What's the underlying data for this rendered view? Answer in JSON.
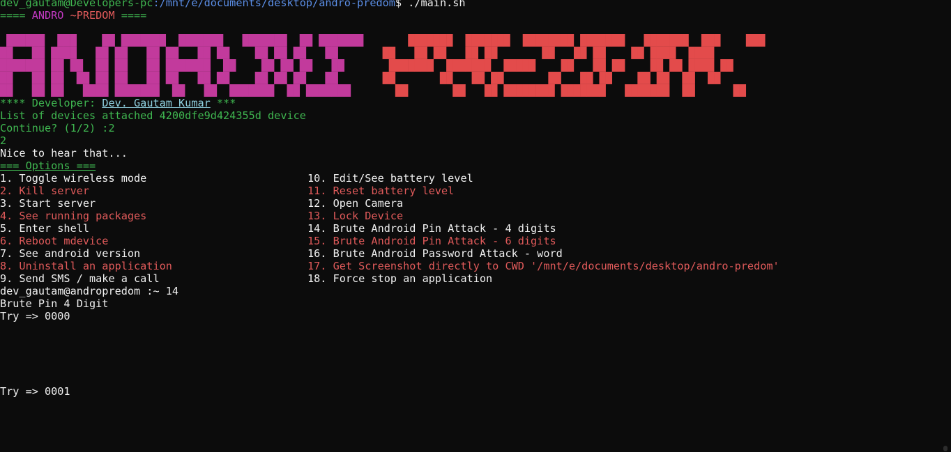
{
  "prompt": {
    "user_host": "dev_gautam@Developers-pc",
    "path": ":/mnt/e/documents/desktop/andro-predom",
    "dollar": "$",
    "command": " ./main.sh"
  },
  "header": {
    "left": "==== ",
    "name1": "ANDRO",
    "name2": " ~PREDOM",
    "right": " ===="
  },
  "banner": {
    "left_lines": [
      " ██████  ███    ██ ███████  ███████   ███████  ██ ███████",
      "██   ██ ████   ██ ██   ██ ██   ██ ██    ██ ██ ██   ██",
      "███████ ██ ██  ██ ██   ██ ███████  ██    ██ ██ ██   ██",
      "██   ██ ██  ██ ██ ██   ██ ██   ██ ██    ██ ██ ██   ██",
      "██   ██ ██   ████ ███████  ██   ██  ███████  ██ ███████"
    ],
    "right_lines": [
      "       ███████  ███████  ████████ ███████   ███████  ███    ███",
      "       ██   ██ ██   ██ ██       ██   ██ ██    ██ ████  ████",
      "       ███████  ███████  █████    ██   ██ ██    ██ ██ ████ ██",
      "       ██       ██   ██ ██       ██   ██ ██    ██ ██  ██  ██",
      "       ██       ██   ██ ████████ ███████   ███████  ██      ██"
    ]
  },
  "developer": {
    "prefix": "**** Developer: ",
    "name": "Dev. Gautam Kumar",
    "suffix": " ***"
  },
  "devices_line": "List of devices attached 4200dfe9d424355d device",
  "continue_line": "Continue? (1/2) :2",
  "echo_line": "2",
  "nice_line": "Nice to hear that...",
  "options_header": "=== Options ===",
  "options_left": [
    {
      "text": "1. Toggle wireless mode",
      "color": "white"
    },
    {
      "text": "2. Kill server",
      "color": "red"
    },
    {
      "text": "3. Start server",
      "color": "white"
    },
    {
      "text": "4. See running packages",
      "color": "red"
    },
    {
      "text": "5. Enter shell",
      "color": "white"
    },
    {
      "text": "6. Reboot mdevice",
      "color": "red"
    },
    {
      "text": "7. See android version",
      "color": "white"
    },
    {
      "text": "8. Uninstall an application",
      "color": "red"
    },
    {
      "text": "9. Send SMS / make a call",
      "color": "white"
    }
  ],
  "options_right": [
    {
      "text": "10. Edit/See battery level",
      "color": "white"
    },
    {
      "text": "11. Reset battery level",
      "color": "red"
    },
    {
      "text": "12. Open Camera",
      "color": "white"
    },
    {
      "text": "13. Lock Device",
      "color": "red"
    },
    {
      "text": "14. Brute Android Pin Attack - 4 digits",
      "color": "white"
    },
    {
      "text": "15. Brute Android Pin Attack - 6 digits",
      "color": "red"
    },
    {
      "text": "16. Brute Android Password Attack - word",
      "color": "white"
    },
    {
      "text": "17. Get Screenshot directly to CWD '/mnt/e/documents/desktop/andro-predom'",
      "color": "red"
    },
    {
      "text": "18. Force stop an application",
      "color": "white"
    }
  ],
  "shell_prompt": "dev_gautam@andropredom :~ 14",
  "brute_line": "Brute Pin 4 Digit",
  "try1": "Try => 0000",
  "try2": "Try => 0001",
  "colors": {
    "background": "#0c0c0c",
    "text": "#f0f0f0",
    "green": "#3fb650",
    "magenta": "#c43ac4",
    "red": "#e05a5a",
    "blue": "#5b8ee6"
  }
}
